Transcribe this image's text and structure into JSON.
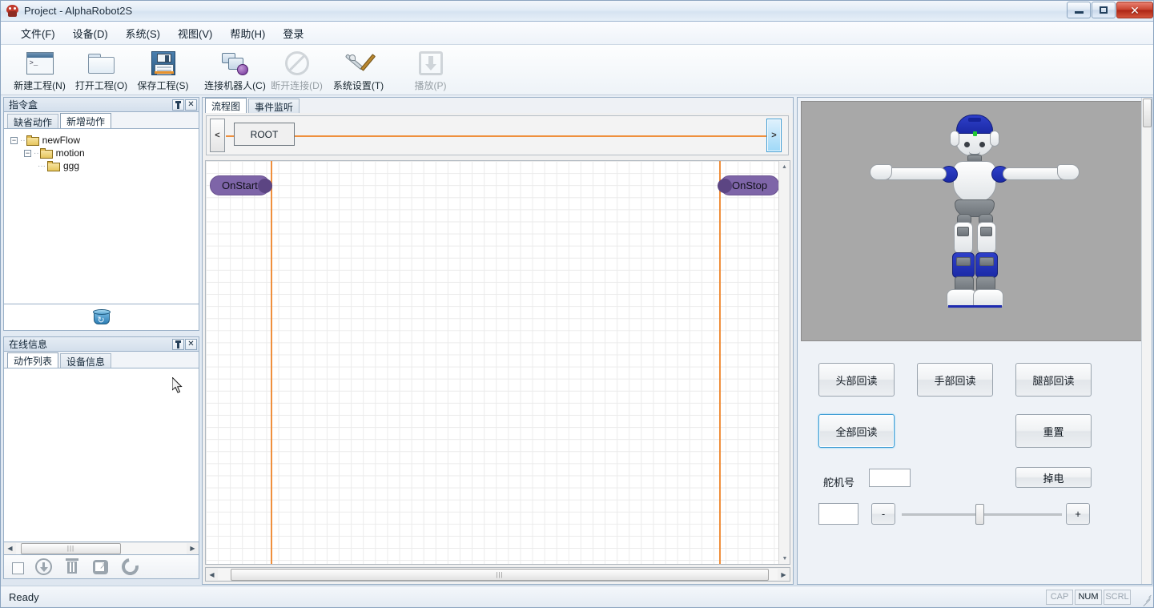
{
  "window": {
    "title": "Project - AlphaRobot2S",
    "app_icon": "robot-icon",
    "minimize_label": "Minimize",
    "maximize_label": "Restore",
    "close_label": "Close"
  },
  "menubar": {
    "items": [
      {
        "label": "文件(F)",
        "name": "menu-file"
      },
      {
        "label": "设备(D)",
        "name": "menu-device"
      },
      {
        "label": "系统(S)",
        "name": "menu-system"
      },
      {
        "label": "视图(V)",
        "name": "menu-view"
      },
      {
        "label": "帮助(H)",
        "name": "menu-help"
      },
      {
        "label": "登录",
        "name": "menu-login"
      }
    ]
  },
  "toolbar": {
    "buttons": [
      {
        "label": "新建工程(N)",
        "icon": "new-project-icon",
        "disabled": false
      },
      {
        "label": "打开工程(O)",
        "icon": "open-project-icon",
        "disabled": false
      },
      {
        "label": "保存工程(S)",
        "icon": "save-project-icon",
        "disabled": false
      },
      {
        "label": "连接机器人(C)",
        "icon": "connect-robot-icon",
        "disabled": false
      },
      {
        "label": "断开连接(D)",
        "icon": "disconnect-icon",
        "disabled": true
      },
      {
        "label": "系统设置(T)",
        "icon": "system-settings-icon",
        "disabled": false
      },
      {
        "label": "播放(P)",
        "icon": "play-download-icon",
        "disabled": true
      }
    ]
  },
  "command_box": {
    "title": "指令盒",
    "tabs": [
      {
        "label": "缺省动作",
        "active": false
      },
      {
        "label": "新增动作",
        "active": true
      }
    ],
    "tree": [
      {
        "label": "newFlow",
        "depth": 0,
        "expanded": true
      },
      {
        "label": "motion",
        "depth": 1,
        "expanded": true
      },
      {
        "label": "ggg",
        "depth": 2,
        "expanded": null
      }
    ],
    "bucket_icon": "recycle-bucket-icon"
  },
  "online_info": {
    "title": "在线信息",
    "tabs": [
      {
        "label": "动作列表",
        "active": true
      },
      {
        "label": "设备信息",
        "active": false
      }
    ],
    "action_buttons": [
      {
        "name": "select-all-checkbox",
        "icon": "checkbox-icon",
        "disabled": true
      },
      {
        "name": "download-button",
        "icon": "download-circle-icon",
        "disabled": true
      },
      {
        "name": "delete-button",
        "icon": "trash-icon",
        "disabled": true
      },
      {
        "name": "export-button",
        "icon": "export-icon",
        "disabled": true
      },
      {
        "name": "refresh-button",
        "icon": "refresh-icon",
        "disabled": true
      }
    ]
  },
  "flowchart": {
    "tabs": [
      {
        "label": "流程图",
        "active": true
      },
      {
        "label": "事件监听",
        "active": false
      }
    ],
    "nav_prev": "<",
    "nav_next": ">",
    "root_node": "ROOT",
    "nodes": [
      {
        "label": "OnStart",
        "knob": "right"
      },
      {
        "label": "OnStop",
        "knob": "left"
      }
    ],
    "colors": {
      "flow_line": "#ef8f3c",
      "node_fill": "#7e65a8",
      "node_knob": "#5c4583"
    }
  },
  "robot_panel": {
    "viewer": {
      "name": "robot-3d-viewer",
      "background": "#a8a8a8",
      "robot": "alpha-robot-t-pose"
    },
    "buttons": [
      {
        "label": "头部回读",
        "name": "read-head-button",
        "focused": false
      },
      {
        "label": "手部回读",
        "name": "read-arm-button",
        "focused": false
      },
      {
        "label": "腿部回读",
        "name": "read-leg-button",
        "focused": false
      },
      {
        "label": "全部回读",
        "name": "read-all-button",
        "focused": true
      },
      {
        "label": "重置",
        "name": "reset-button",
        "focused": false
      },
      {
        "label": "掉电",
        "name": "power-off-button",
        "focused": false
      }
    ],
    "servo_label": "舵机号",
    "servo_value": "",
    "angle_value": "",
    "minus_label": "-",
    "plus_label": "+",
    "slider_percent": 52
  },
  "statusbar": {
    "text": "Ready",
    "indicators": [
      {
        "label": "CAP",
        "active": false
      },
      {
        "label": "NUM",
        "active": true
      },
      {
        "label": "SCRL",
        "active": false
      }
    ]
  }
}
